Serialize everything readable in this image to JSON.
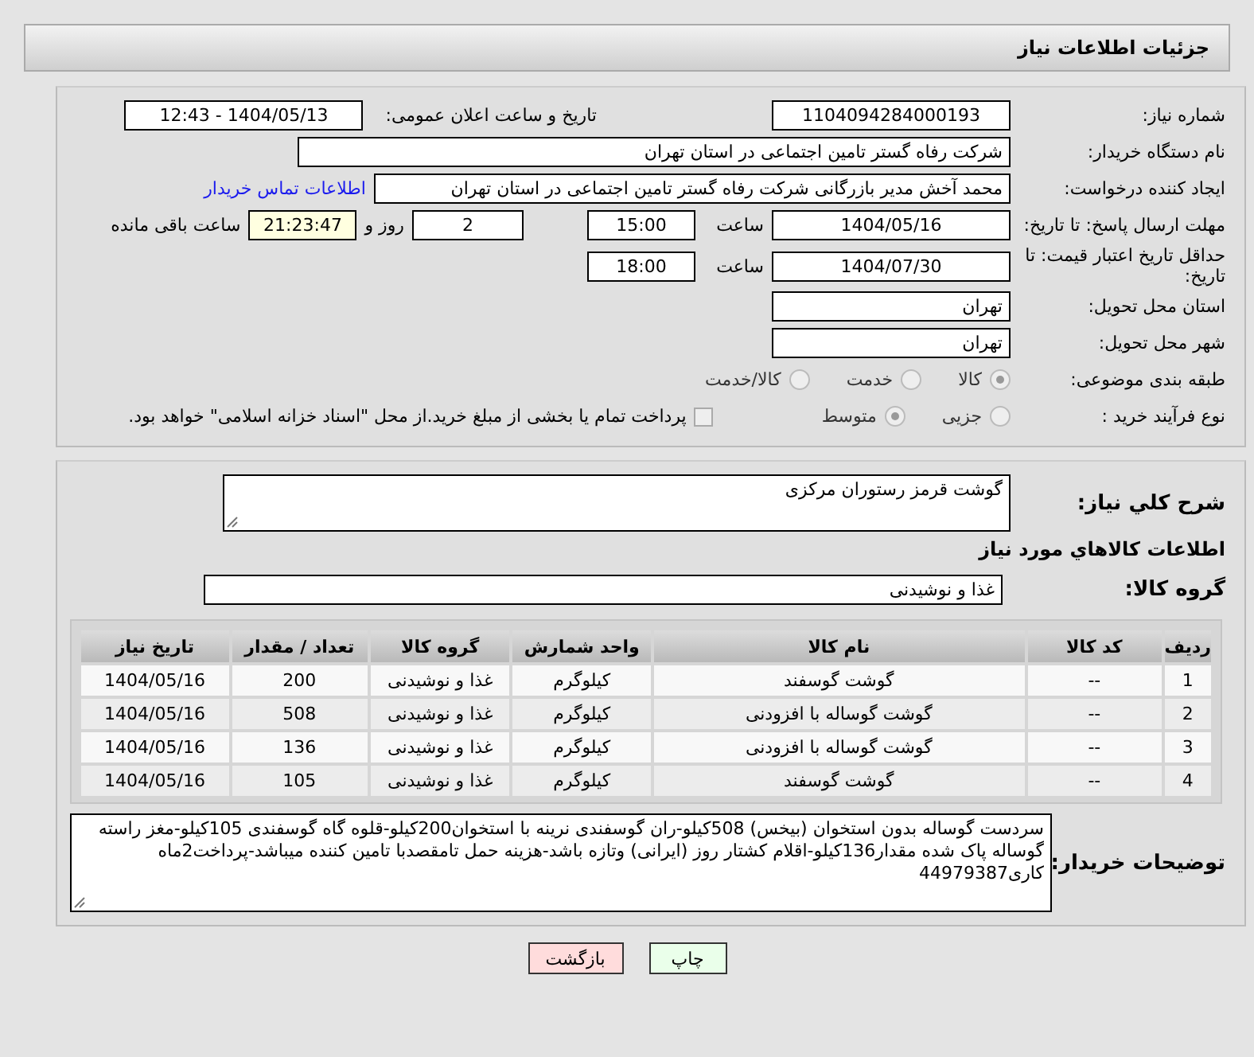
{
  "header": {
    "title": "جزئیات اطلاعات نیاز"
  },
  "need_number": {
    "label": "شماره نیاز:",
    "value": "1104094284000193"
  },
  "announce": {
    "label": "تاریخ و ساعت اعلان عمومی:",
    "value": "1404/05/13 - 12:43"
  },
  "buyer_org": {
    "label": "نام دستگاه خریدار:",
    "value": "شرکت رفاه گستر تامین اجتماعی در استان تهران"
  },
  "requester": {
    "label": "ایجاد کننده درخواست:",
    "value": "محمد آخش مدیر بازرگانی شرکت رفاه گستر تامین اجتماعی در استان تهران",
    "link": "اطلاعات تماس خریدار"
  },
  "reply_deadline": {
    "label": "مهلت ارسال پاسخ: تا تاریخ:",
    "date": "1404/05/16",
    "time_label": "ساعت",
    "time": "15:00",
    "days": "2",
    "days_label": "روز و",
    "remaining": "21:23:47",
    "remaining_label": "ساعت باقی مانده"
  },
  "price_validity": {
    "label": "حداقل تاریخ اعتبار قیمت: تا تاریخ:",
    "date": "1404/07/30",
    "time_label": "ساعت",
    "time": "18:00"
  },
  "province": {
    "label": "استان محل تحویل:",
    "value": "تهران"
  },
  "city": {
    "label": "شهر محل تحویل:",
    "value": "تهران"
  },
  "category": {
    "label": "طبقه بندی موضوعی:",
    "options": [
      {
        "label": "کالا",
        "selected": true
      },
      {
        "label": "خدمت",
        "selected": false
      },
      {
        "label": "کالا/خدمت",
        "selected": false
      }
    ]
  },
  "process": {
    "label": "نوع فرآیند خرید :",
    "options": [
      {
        "label": "جزیی",
        "selected": false
      },
      {
        "label": "متوسط",
        "selected": true
      }
    ],
    "treasury": {
      "label": "پرداخت تمام یا بخشی از مبلغ خرید.از محل \"اسناد خزانه اسلامی\" خواهد بود.",
      "checked": false
    }
  },
  "description": {
    "label": "شرح کلي نياز:",
    "value": "گوشت قرمز رستوران مرکزی"
  },
  "goods_title": "اطلاعات کالاهاي مورد نياز",
  "goods_group": {
    "label": "گروه کالا:",
    "value": "غذا و نوشیدنی"
  },
  "table": {
    "columns": [
      "ردیف",
      "کد کالا",
      "نام کالا",
      "واحد شمارش",
      "گروه کالا",
      "تعداد / مقدار",
      "تاریخ نیاز"
    ],
    "rows": [
      [
        "1",
        "--",
        "گوشت گوسفند",
        "کیلوگرم",
        "غذا و نوشیدنی",
        "200",
        "1404/05/16"
      ],
      [
        "2",
        "--",
        "گوشت گوساله با افزودنی",
        "کیلوگرم",
        "غذا و نوشیدنی",
        "508",
        "1404/05/16"
      ],
      [
        "3",
        "--",
        "گوشت گوساله با افزودنی",
        "کیلوگرم",
        "غذا و نوشیدنی",
        "136",
        "1404/05/16"
      ],
      [
        "4",
        "--",
        "گوشت گوسفند",
        "کیلوگرم",
        "غذا و نوشیدنی",
        "105",
        "1404/05/16"
      ]
    ]
  },
  "buyer_notes": {
    "label": "توضیحات خریدار:",
    "value": "سردست گوساله بدون استخوان (بیخس) 508کیلو-ران گوسفندی نرینه با استخوان200کیلو-قلوه گاه گوسفندی 105کیلو-مغز راسته گوساله پاک شده مقدار136کیلو-اقلام کشتار روز (ایرانی) وتازه باشد-هزینه حمل تامقصدبا تامین کننده میباشد-پرداخت2ماه کاری44979387"
  },
  "buttons": [
    {
      "label": "چاپ",
      "kind": "print"
    },
    {
      "label": "بازگشت",
      "kind": "back"
    }
  ]
}
